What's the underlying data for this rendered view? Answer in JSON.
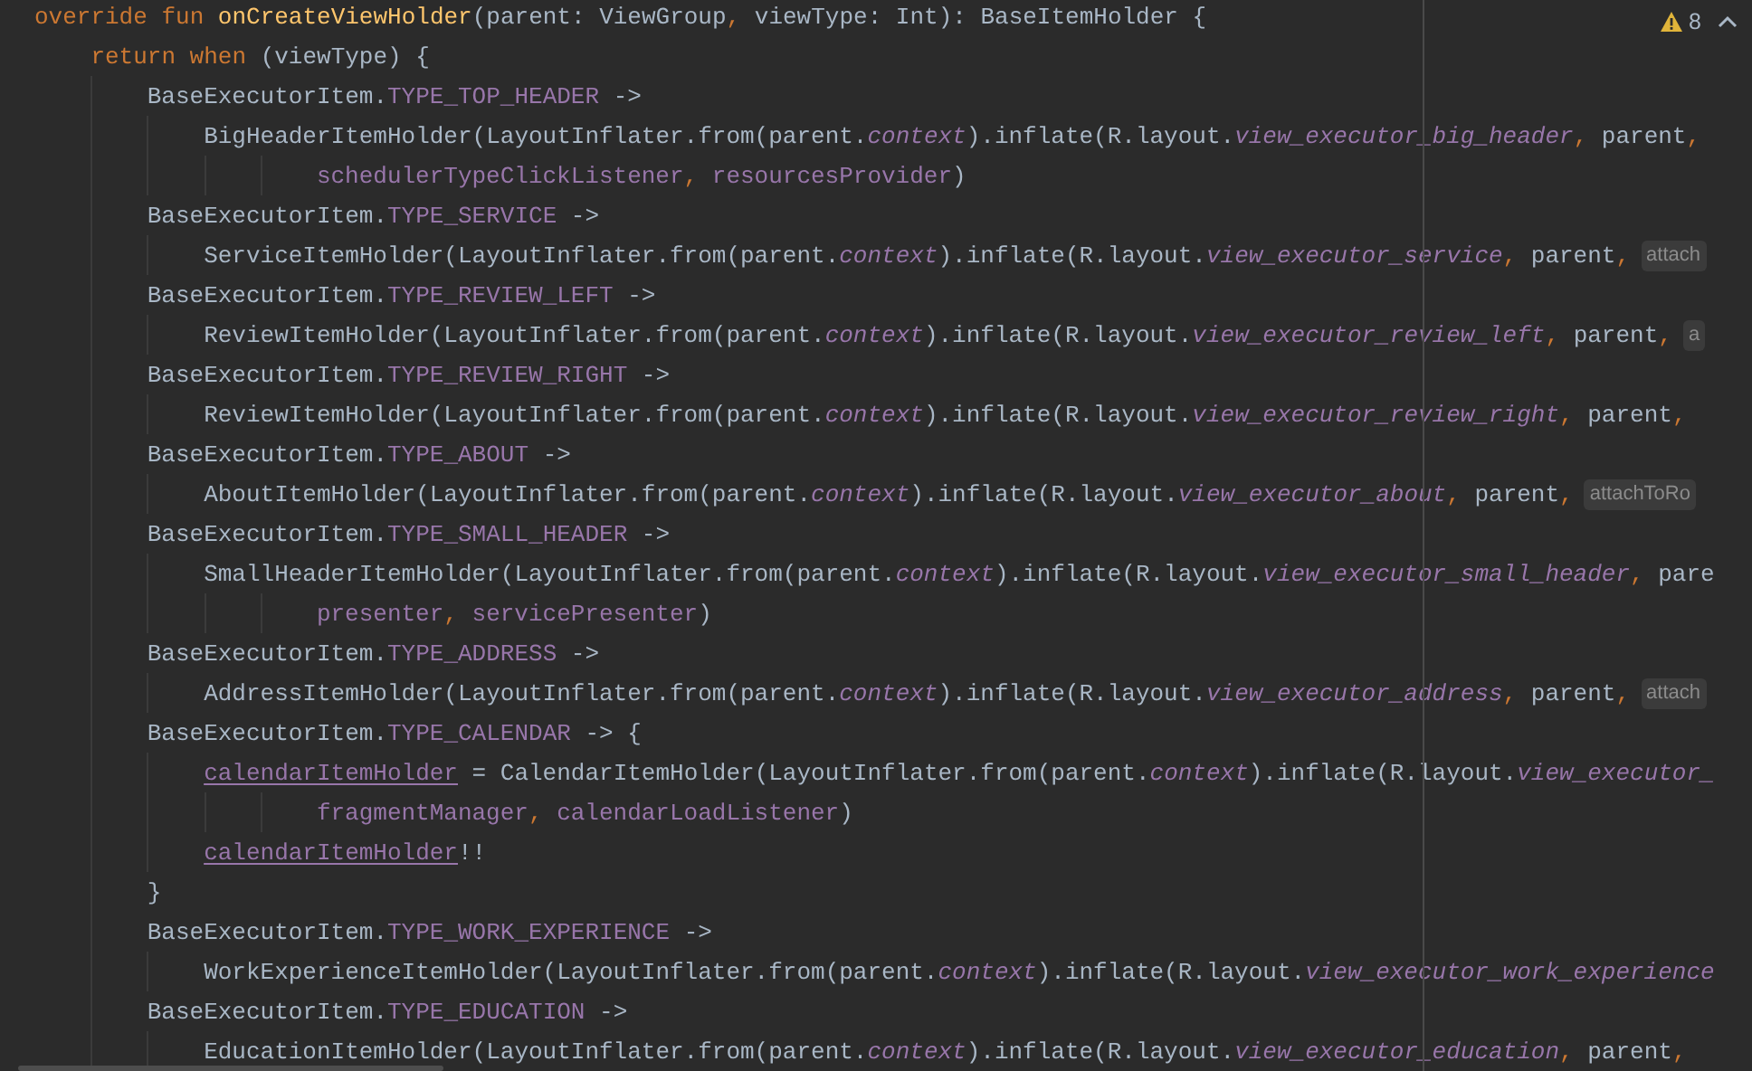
{
  "editor": {
    "warnings": "8",
    "lines": [
      {
        "kind": "statement",
        "tokens": [
          {
            "text": "override fun ",
            "kind": "keyword"
          },
          {
            "text": "onCreateViewHolder",
            "kind": "function"
          },
          {
            "text": "(parent: ViewGroup",
            "kind": "plain"
          },
          {
            "text": ", ",
            "kind": "comma"
          },
          {
            "text": "viewType: Int): BaseItemHolder {",
            "kind": "plain"
          }
        ],
        "children": [
          {
            "kind": "statement",
            "tokens": [
              {
                "text": "return when ",
                "kind": "keyword"
              },
              {
                "text": "(viewType) {",
                "kind": "plain"
              }
            ],
            "children": [
              {
                "kind": "statement",
                "tokens": [
                  {
                    "text": "BaseExecutorItem.",
                    "kind": "plain"
                  },
                  {
                    "text": "TYPE_TOP_HEADER",
                    "kind": "constant"
                  },
                  {
                    "text": " ->",
                    "kind": "plain"
                  }
                ],
                "children": [
                  {
                    "kind": "statement",
                    "tokens": [
                      {
                        "text": "BigHeaderItemHolder(LayoutInflater.from(parent.",
                        "kind": "plain"
                      },
                      {
                        "text": "context",
                        "kind": "static"
                      },
                      {
                        "text": ").inflate(R.layout.",
                        "kind": "plain"
                      },
                      {
                        "text": "view_executor_big_header",
                        "kind": "static"
                      },
                      {
                        "text": ", ",
                        "kind": "comma"
                      },
                      {
                        "text": "parent",
                        "kind": "plain"
                      },
                      {
                        "text": ",",
                        "kind": "comma"
                      }
                    ],
                    "children": [
                      {
                        "kind": "continuation",
                        "tokens": [
                          {
                            "text": "schedulerTypeClickListener",
                            "kind": "property"
                          },
                          {
                            "text": ", ",
                            "kind": "comma"
                          },
                          {
                            "text": "resourcesProvider",
                            "kind": "property"
                          },
                          {
                            "text": ")",
                            "kind": "plain"
                          }
                        ]
                      }
                    ]
                  }
                ]
              },
              {
                "kind": "statement",
                "tokens": [
                  {
                    "text": "BaseExecutorItem.",
                    "kind": "plain"
                  },
                  {
                    "text": "TYPE_SERVICE",
                    "kind": "constant"
                  },
                  {
                    "text": " ->",
                    "kind": "plain"
                  }
                ],
                "children": [
                  {
                    "kind": "statement",
                    "tokens": [
                      {
                        "text": "ServiceItemHolder(LayoutInflater.from(parent.",
                        "kind": "plain"
                      },
                      {
                        "text": "context",
                        "kind": "static"
                      },
                      {
                        "text": ").inflate(R.layout.",
                        "kind": "plain"
                      },
                      {
                        "text": "view_executor_service",
                        "kind": "static"
                      },
                      {
                        "text": ", ",
                        "kind": "comma"
                      },
                      {
                        "text": "parent",
                        "kind": "plain"
                      },
                      {
                        "text": ",",
                        "kind": "comma"
                      }
                    ],
                    "hint": "attach"
                  }
                ]
              },
              {
                "kind": "statement",
                "tokens": [
                  {
                    "text": "BaseExecutorItem.",
                    "kind": "plain"
                  },
                  {
                    "text": "TYPE_REVIEW_LEFT",
                    "kind": "constant"
                  },
                  {
                    "text": " ->",
                    "kind": "plain"
                  }
                ],
                "children": [
                  {
                    "kind": "statement",
                    "tokens": [
                      {
                        "text": "ReviewItemHolder(LayoutInflater.from(parent.",
                        "kind": "plain"
                      },
                      {
                        "text": "context",
                        "kind": "static"
                      },
                      {
                        "text": ").inflate(R.layout.",
                        "kind": "plain"
                      },
                      {
                        "text": "view_executor_review_left",
                        "kind": "static"
                      },
                      {
                        "text": ", ",
                        "kind": "comma"
                      },
                      {
                        "text": "parent",
                        "kind": "plain"
                      },
                      {
                        "text": ",",
                        "kind": "comma"
                      }
                    ],
                    "hint": "a"
                  }
                ]
              },
              {
                "kind": "statement",
                "tokens": [
                  {
                    "text": "BaseExecutorItem.",
                    "kind": "plain"
                  },
                  {
                    "text": "TYPE_REVIEW_RIGHT",
                    "kind": "constant"
                  },
                  {
                    "text": " ->",
                    "kind": "plain"
                  }
                ],
                "children": [
                  {
                    "kind": "statement",
                    "tokens": [
                      {
                        "text": "ReviewItemHolder(LayoutInflater.from(parent.",
                        "kind": "plain"
                      },
                      {
                        "text": "context",
                        "kind": "static"
                      },
                      {
                        "text": ").inflate(R.layout.",
                        "kind": "plain"
                      },
                      {
                        "text": "view_executor_review_right",
                        "kind": "static"
                      },
                      {
                        "text": ", ",
                        "kind": "comma"
                      },
                      {
                        "text": "parent",
                        "kind": "plain"
                      },
                      {
                        "text": ",",
                        "kind": "comma"
                      }
                    ]
                  }
                ]
              },
              {
                "kind": "statement",
                "tokens": [
                  {
                    "text": "BaseExecutorItem.",
                    "kind": "plain"
                  },
                  {
                    "text": "TYPE_ABOUT",
                    "kind": "constant"
                  },
                  {
                    "text": " ->",
                    "kind": "plain"
                  }
                ],
                "children": [
                  {
                    "kind": "statement",
                    "tokens": [
                      {
                        "text": "AboutItemHolder(LayoutInflater.from(parent.",
                        "kind": "plain"
                      },
                      {
                        "text": "context",
                        "kind": "static"
                      },
                      {
                        "text": ").inflate(R.layout.",
                        "kind": "plain"
                      },
                      {
                        "text": "view_executor_about",
                        "kind": "static"
                      },
                      {
                        "text": ", ",
                        "kind": "comma"
                      },
                      {
                        "text": "parent",
                        "kind": "plain"
                      },
                      {
                        "text": ",",
                        "kind": "comma"
                      }
                    ],
                    "hint": "attachToRo"
                  }
                ]
              },
              {
                "kind": "statement",
                "tokens": [
                  {
                    "text": "BaseExecutorItem.",
                    "kind": "plain"
                  },
                  {
                    "text": "TYPE_SMALL_HEADER",
                    "kind": "constant"
                  },
                  {
                    "text": " ->",
                    "kind": "plain"
                  }
                ],
                "children": [
                  {
                    "kind": "statement",
                    "tokens": [
                      {
                        "text": "SmallHeaderItemHolder(LayoutInflater.from(parent.",
                        "kind": "plain"
                      },
                      {
                        "text": "context",
                        "kind": "static"
                      },
                      {
                        "text": ").inflate(R.layout.",
                        "kind": "plain"
                      },
                      {
                        "text": "view_executor_small_header",
                        "kind": "static"
                      },
                      {
                        "text": ", ",
                        "kind": "comma"
                      },
                      {
                        "text": "pare",
                        "kind": "plain"
                      }
                    ],
                    "children": [
                      {
                        "kind": "continuation",
                        "tokens": [
                          {
                            "text": "presenter",
                            "kind": "property"
                          },
                          {
                            "text": ", ",
                            "kind": "comma"
                          },
                          {
                            "text": "servicePresenter",
                            "kind": "property"
                          },
                          {
                            "text": ")",
                            "kind": "plain"
                          }
                        ]
                      }
                    ]
                  }
                ]
              },
              {
                "kind": "statement",
                "tokens": [
                  {
                    "text": "BaseExecutorItem.",
                    "kind": "plain"
                  },
                  {
                    "text": "TYPE_ADDRESS",
                    "kind": "constant"
                  },
                  {
                    "text": " ->",
                    "kind": "plain"
                  }
                ],
                "children": [
                  {
                    "kind": "statement",
                    "tokens": [
                      {
                        "text": "AddressItemHolder(LayoutInflater.from(parent.",
                        "kind": "plain"
                      },
                      {
                        "text": "context",
                        "kind": "static"
                      },
                      {
                        "text": ").inflate(R.layout.",
                        "kind": "plain"
                      },
                      {
                        "text": "view_executor_address",
                        "kind": "static"
                      },
                      {
                        "text": ", ",
                        "kind": "comma"
                      },
                      {
                        "text": "parent",
                        "kind": "plain"
                      },
                      {
                        "text": ",",
                        "kind": "comma"
                      }
                    ],
                    "hint": "attach"
                  }
                ]
              },
              {
                "kind": "statement",
                "tokens": [
                  {
                    "text": "BaseExecutorItem.",
                    "kind": "plain"
                  },
                  {
                    "text": "TYPE_CALENDAR",
                    "kind": "constant"
                  },
                  {
                    "text": " -> {",
                    "kind": "plain"
                  }
                ],
                "children": [
                  {
                    "kind": "statement",
                    "tokens": [
                      {
                        "text": "calendarItemHolder",
                        "kind": "variable"
                      },
                      {
                        "text": " = CalendarItemHolder(LayoutInflater.from(parent.",
                        "kind": "plain"
                      },
                      {
                        "text": "context",
                        "kind": "static"
                      },
                      {
                        "text": ").inflate(R.layout.",
                        "kind": "plain"
                      },
                      {
                        "text": "view_executor_",
                        "kind": "static"
                      }
                    ],
                    "children": [
                      {
                        "kind": "continuation",
                        "tokens": [
                          {
                            "text": "fragmentManager",
                            "kind": "property"
                          },
                          {
                            "text": ", ",
                            "kind": "comma"
                          },
                          {
                            "text": "calendarLoadListener",
                            "kind": "property"
                          },
                          {
                            "text": ")",
                            "kind": "plain"
                          }
                        ]
                      }
                    ]
                  },
                  {
                    "kind": "statement",
                    "tokens": [
                      {
                        "text": "calendarItemHolder",
                        "kind": "variable"
                      },
                      {
                        "text": "!!",
                        "kind": "plain"
                      }
                    ]
                  }
                ]
              },
              {
                "kind": "statement",
                "tokens": [
                  {
                    "text": "}",
                    "kind": "plain"
                  }
                ]
              },
              {
                "kind": "statement",
                "tokens": [
                  {
                    "text": "BaseExecutorItem.",
                    "kind": "plain"
                  },
                  {
                    "text": "TYPE_WORK_EXPERIENCE",
                    "kind": "constant"
                  },
                  {
                    "text": " ->",
                    "kind": "plain"
                  }
                ],
                "children": [
                  {
                    "kind": "statement",
                    "tokens": [
                      {
                        "text": "WorkExperienceItemHolder(LayoutInflater.from(parent.",
                        "kind": "plain"
                      },
                      {
                        "text": "context",
                        "kind": "static"
                      },
                      {
                        "text": ").inflate(R.layout.",
                        "kind": "plain"
                      },
                      {
                        "text": "view_executor_work_experience",
                        "kind": "static"
                      }
                    ]
                  }
                ]
              },
              {
                "kind": "statement",
                "tokens": [
                  {
                    "text": "BaseExecutorItem.",
                    "kind": "plain"
                  },
                  {
                    "text": "TYPE_EDUCATION",
                    "kind": "constant"
                  },
                  {
                    "text": " ->",
                    "kind": "plain"
                  }
                ],
                "children": [
                  {
                    "kind": "statement",
                    "tokens": [
                      {
                        "text": "EducationItemHolder(LayoutInflater.from(parent.",
                        "kind": "plain"
                      },
                      {
                        "text": "context",
                        "kind": "static"
                      },
                      {
                        "text": ").inflate(R.layout.",
                        "kind": "plain"
                      },
                      {
                        "text": "view_executor_education",
                        "kind": "static"
                      },
                      {
                        "text": ", ",
                        "kind": "comma"
                      },
                      {
                        "text": "parent",
                        "kind": "plain"
                      },
                      {
                        "text": ",",
                        "kind": "comma"
                      }
                    ]
                  }
                ]
              }
            ]
          }
        ]
      }
    ]
  }
}
